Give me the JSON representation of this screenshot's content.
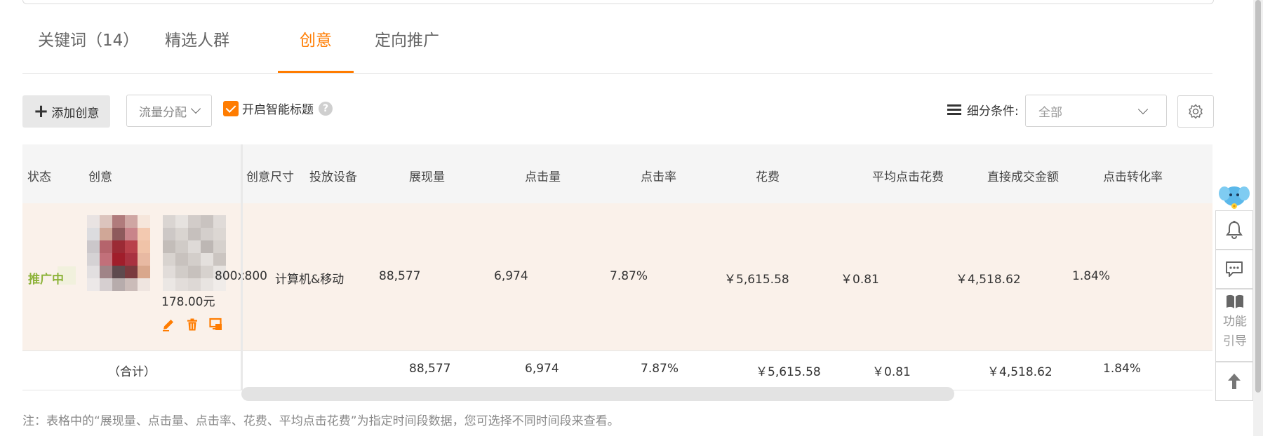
{
  "tabs": [
    {
      "label": "关键词（14）"
    },
    {
      "label": "精选人群"
    },
    {
      "label": "创意"
    },
    {
      "label": "定向推广"
    }
  ],
  "toolbar": {
    "add_label": "添加创意",
    "flow_label": "流量分配",
    "smart_title_label": "开启智能标题",
    "help_glyph": "?",
    "condition_label": "细分条件:",
    "condition_value": "全部"
  },
  "table": {
    "headers": [
      "状态",
      "创意",
      "创意尺寸",
      "投放设备",
      "展现量",
      "点击量",
      "点击率",
      "花费",
      "平均点击花费",
      "直接成交金额",
      "点击转化率"
    ],
    "row": {
      "status": "推广中",
      "price": "178.00元",
      "size": "800x800",
      "device": "计算机&移动",
      "impressions": "88,577",
      "clicks": "6,974",
      "ctr": "7.87%",
      "cost": "￥5,615.58",
      "cpc": "￥0.81",
      "gmv": "￥4,518.62",
      "cvr": "1.84%"
    },
    "total": {
      "label": "（合计）",
      "impressions": "88,577",
      "clicks": "6,974",
      "ctr": "7.87%",
      "cost": "￥5,615.58",
      "cpc": "￥0.81",
      "gmv": "￥4,518.62",
      "cvr": "1.84%"
    }
  },
  "note": "注：表格中的“展现量、点击量、点击率、花费、平均点击花费”为指定时间段数据，您可选择不同时间段来查看。",
  "sidebar": {
    "guide_line1": "功能",
    "guide_line2": "引导"
  },
  "icons": [
    "plus-icon",
    "chevron-down-icon",
    "checkbox-checked-icon",
    "help-icon",
    "list-icon",
    "gear-icon",
    "edit-icon",
    "delete-icon",
    "preview-icon",
    "mascot-icon",
    "bell-icon",
    "chat-icon",
    "book-icon",
    "arrow-up-icon"
  ],
  "colors": {
    "accent": "#ff7c00",
    "status": "#8db33a",
    "row_highlight": "#faf1ea"
  }
}
